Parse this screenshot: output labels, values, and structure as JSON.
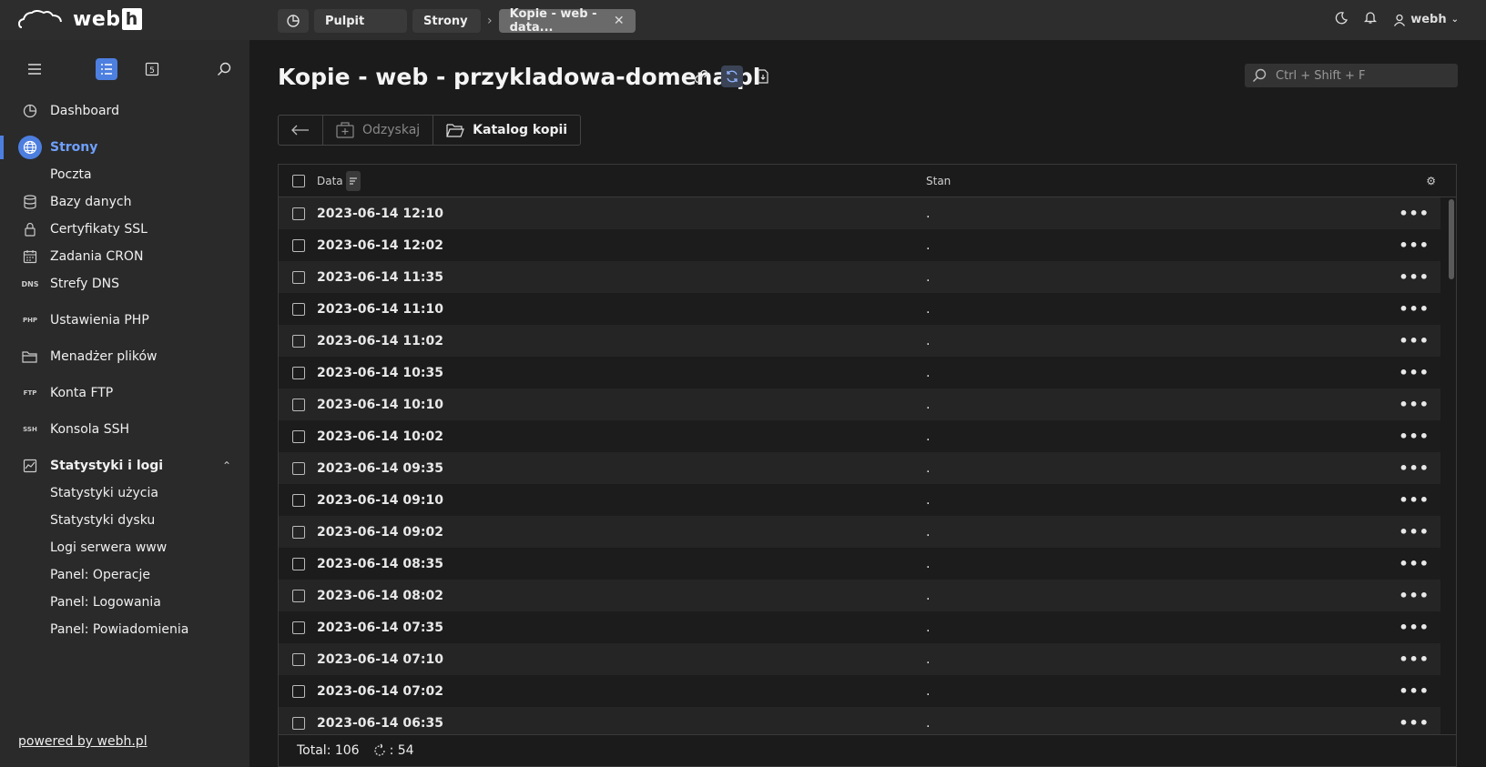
{
  "app": {
    "logo_text": "web",
    "logo_letter": "h"
  },
  "tabs": [
    {
      "label": "Pulpit"
    },
    {
      "label": "Strony"
    },
    {
      "label": "Kopie - web - data..."
    }
  ],
  "topbar": {
    "user": "webh"
  },
  "sidebar": {
    "items": [
      {
        "label": "Dashboard",
        "icon": "dashboard-icon"
      },
      {
        "label": "Strony",
        "icon": "globe-icon",
        "active": true
      },
      {
        "label": "Poczta"
      },
      {
        "label": "Bazy danych",
        "icon": "database-icon"
      },
      {
        "label": "Certyfikaty SSL",
        "icon": "lock-icon"
      },
      {
        "label": "Zadania CRON",
        "icon": "calendar-icon"
      },
      {
        "label": "Strefy DNS",
        "icon": "dns-icon"
      },
      {
        "label": "Ustawienia PHP",
        "icon": "php-icon"
      },
      {
        "label": "Menadżer plików",
        "icon": "folder-icon"
      },
      {
        "label": "Konta FTP",
        "icon": "ftp-icon"
      },
      {
        "label": "Konsola SSH",
        "icon": "ssh-icon"
      },
      {
        "label": "Statystyki i logi",
        "icon": "chart-icon"
      },
      {
        "label": "Statystyki użycia"
      },
      {
        "label": "Statystyki dysku"
      },
      {
        "label": "Logi serwera www"
      },
      {
        "label": "Panel: Operacje"
      },
      {
        "label": "Panel: Logowania"
      },
      {
        "label": "Panel: Powiadomienia"
      }
    ],
    "powered_by": "powered by webh.pl"
  },
  "main": {
    "title": "Kopie - web - przykladowa-domena.pl",
    "search_placeholder": "Ctrl + Shift + F",
    "toolbar": {
      "restore_label": "Odzyskaj",
      "catalog_label": "Katalog kopii"
    },
    "table": {
      "columns": {
        "date": "Data",
        "status": "Stan"
      },
      "rows": [
        {
          "date": "2023-06-14 12:10",
          "status": "."
        },
        {
          "date": "2023-06-14 12:02",
          "status": "."
        },
        {
          "date": "2023-06-14 11:35",
          "status": "."
        },
        {
          "date": "2023-06-14 11:10",
          "status": "."
        },
        {
          "date": "2023-06-14 11:02",
          "status": "."
        },
        {
          "date": "2023-06-14 10:35",
          "status": "."
        },
        {
          "date": "2023-06-14 10:10",
          "status": "."
        },
        {
          "date": "2023-06-14 10:02",
          "status": "."
        },
        {
          "date": "2023-06-14 09:35",
          "status": "."
        },
        {
          "date": "2023-06-14 09:10",
          "status": "."
        },
        {
          "date": "2023-06-14 09:02",
          "status": "."
        },
        {
          "date": "2023-06-14 08:35",
          "status": "."
        },
        {
          "date": "2023-06-14 08:02",
          "status": "."
        },
        {
          "date": "2023-06-14 07:35",
          "status": "."
        },
        {
          "date": "2023-06-14 07:10",
          "status": "."
        },
        {
          "date": "2023-06-14 07:02",
          "status": "."
        },
        {
          "date": "2023-06-14 06:35",
          "status": "."
        }
      ],
      "total_label": "Total: 106",
      "reload_count": ": 54"
    }
  },
  "colors": {
    "accent": "#4d7fe0",
    "sidebar_bg": "#2a2a2a",
    "main_bg": "#1b1b1b",
    "topbar_bg": "#2d2d2d"
  }
}
